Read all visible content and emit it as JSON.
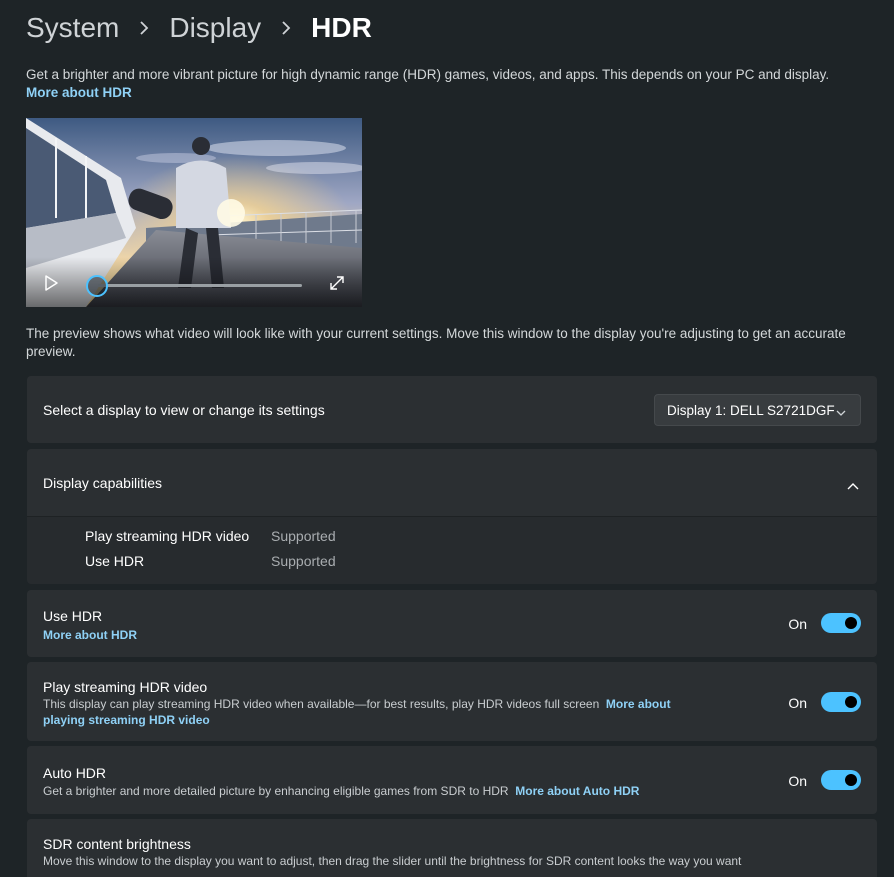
{
  "breadcrumb": {
    "items": [
      "System",
      "Display",
      "HDR"
    ]
  },
  "intro": {
    "text": "Get a brighter and more vibrant picture for high dynamic range (HDR) games, videos, and apps. This depends on your PC and display.",
    "link": "More about HDR"
  },
  "video": {
    "progress": 0
  },
  "preview_note": "The preview shows what video will look like with your current settings. Move this window to the display you're adjusting to get an accurate preview.",
  "select_display": {
    "label": "Select a display to view or change its settings",
    "value": "Display 1: DELL S2721DGF"
  },
  "capabilities": {
    "title": "Display capabilities",
    "rows": [
      {
        "name": "Play streaming HDR video",
        "value": "Supported"
      },
      {
        "name": "Use HDR",
        "value": "Supported"
      }
    ]
  },
  "use_hdr": {
    "title": "Use HDR",
    "link": "More about HDR",
    "state": "On"
  },
  "streaming": {
    "title": "Play streaming HDR video",
    "desc": "This display can play streaming HDR video when available—for best results, play HDR videos full screen",
    "link": "More about playing streaming HDR video",
    "state": "On"
  },
  "auto_hdr": {
    "title": "Auto HDR",
    "desc": "Get a brighter and more detailed picture by enhancing eligible games from SDR to HDR",
    "link": "More about Auto HDR",
    "state": "On"
  },
  "sdr": {
    "title": "SDR content brightness",
    "desc": "Move this window to the display you want to adjust, then drag the slider until the brightness for SDR content looks the way you want"
  },
  "colors": {
    "accent": "#4cc2ff",
    "link": "#8fd1f6",
    "background": "#1e2427",
    "card": "#2b2f32"
  }
}
